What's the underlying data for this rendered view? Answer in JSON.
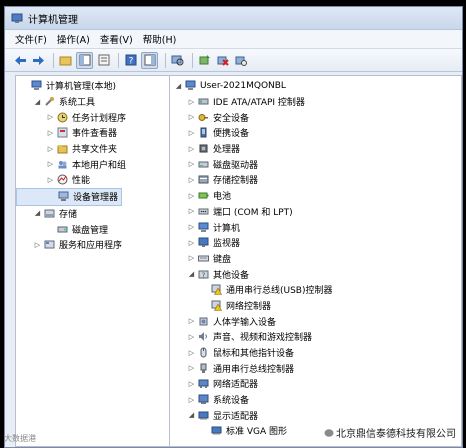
{
  "window": {
    "title": "计算机管理"
  },
  "menu": [
    "文件(F)",
    "操作(A)",
    "查看(V)",
    "帮助(H)"
  ],
  "left_tree": [
    {
      "label": "计算机管理(本地)",
      "indent": 0,
      "exp": "",
      "icon": "computer-icon"
    },
    {
      "label": "系统工具",
      "indent": 1,
      "exp": "◢",
      "icon": "tools-icon"
    },
    {
      "label": "任务计划程序",
      "indent": 2,
      "exp": "▷",
      "icon": "clock-icon"
    },
    {
      "label": "事件查看器",
      "indent": 2,
      "exp": "▷",
      "icon": "event-viewer-icon"
    },
    {
      "label": "共享文件夹",
      "indent": 2,
      "exp": "▷",
      "icon": "folder-icon"
    },
    {
      "label": "本地用户和组",
      "indent": 2,
      "exp": "▷",
      "icon": "users-icon"
    },
    {
      "label": "性能",
      "indent": 2,
      "exp": "▷",
      "icon": "performance-icon"
    },
    {
      "label": "设备管理器",
      "indent": 2,
      "exp": "",
      "icon": "device-manager-icon",
      "selected": true
    },
    {
      "label": "存储",
      "indent": 1,
      "exp": "◢",
      "icon": "storage-icon"
    },
    {
      "label": "磁盘管理",
      "indent": 2,
      "exp": "",
      "icon": "disk-icon"
    },
    {
      "label": "服务和应用程序",
      "indent": 1,
      "exp": "▷",
      "icon": "services-icon"
    }
  ],
  "right_tree": [
    {
      "label": "User-2021MQONBL",
      "indent": 0,
      "exp": "◢",
      "icon": "computer-icon"
    },
    {
      "label": "IDE ATA/ATAPI 控制器",
      "indent": 1,
      "exp": "▷",
      "icon": "ide-controller-icon"
    },
    {
      "label": "安全设备",
      "indent": 1,
      "exp": "▷",
      "icon": "security-device-icon"
    },
    {
      "label": "便携设备",
      "indent": 1,
      "exp": "▷",
      "icon": "portable-device-icon"
    },
    {
      "label": "处理器",
      "indent": 1,
      "exp": "▷",
      "icon": "processor-icon"
    },
    {
      "label": "磁盘驱动器",
      "indent": 1,
      "exp": "▷",
      "icon": "disk-drive-icon"
    },
    {
      "label": "存储控制器",
      "indent": 1,
      "exp": "▷",
      "icon": "storage-controller-icon"
    },
    {
      "label": "电池",
      "indent": 1,
      "exp": "▷",
      "icon": "battery-icon"
    },
    {
      "label": "端口 (COM 和 LPT)",
      "indent": 1,
      "exp": "▷",
      "icon": "port-icon"
    },
    {
      "label": "计算机",
      "indent": 1,
      "exp": "▷",
      "icon": "computer-icon"
    },
    {
      "label": "监视器",
      "indent": 1,
      "exp": "▷",
      "icon": "monitor-icon"
    },
    {
      "label": "键盘",
      "indent": 1,
      "exp": "▷",
      "icon": "keyboard-icon"
    },
    {
      "label": "其他设备",
      "indent": 1,
      "exp": "◢",
      "icon": "other-devices-icon"
    },
    {
      "label": "通用串行总线(USB)控制器",
      "indent": 2,
      "exp": "",
      "icon": "warning-device-icon"
    },
    {
      "label": "网络控制器",
      "indent": 2,
      "exp": "",
      "icon": "warning-device-icon"
    },
    {
      "label": "人体学输入设备",
      "indent": 1,
      "exp": "▷",
      "icon": "hid-icon"
    },
    {
      "label": "声音、视频和游戏控制器",
      "indent": 1,
      "exp": "▷",
      "icon": "sound-icon"
    },
    {
      "label": "鼠标和其他指针设备",
      "indent": 1,
      "exp": "▷",
      "icon": "mouse-icon"
    },
    {
      "label": "通用串行总线控制器",
      "indent": 1,
      "exp": "▷",
      "icon": "usb-icon"
    },
    {
      "label": "网络适配器",
      "indent": 1,
      "exp": "▷",
      "icon": "network-adapter-icon"
    },
    {
      "label": "系统设备",
      "indent": 1,
      "exp": "▷",
      "icon": "system-device-icon"
    },
    {
      "label": "显示适配器",
      "indent": 1,
      "exp": "◢",
      "icon": "display-adapter-icon"
    },
    {
      "label": "标准 VGA 图形",
      "indent": 2,
      "exp": "",
      "icon": "display-adapter-icon"
    }
  ],
  "watermark": "大数据港",
  "corner_text": "北京鼎信泰德科技有限公司"
}
